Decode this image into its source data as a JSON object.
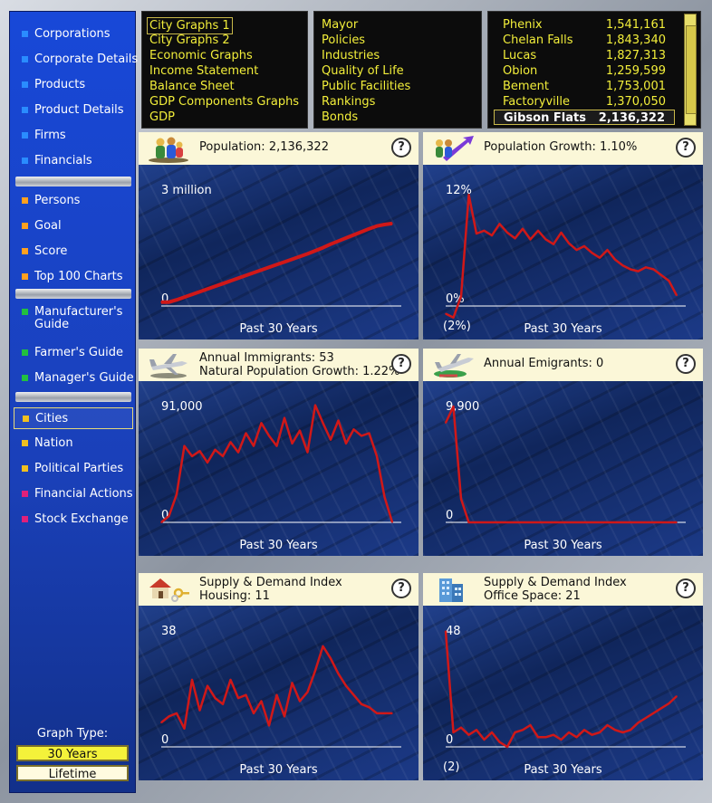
{
  "sidebar": {
    "items": [
      {
        "label": "Corporations",
        "color": "#2a8cff",
        "selected": false,
        "two_line": false
      },
      {
        "label": "Corporate Details",
        "color": "#2a8cff",
        "selected": false,
        "two_line": false
      },
      {
        "label": "Products",
        "color": "#2a8cff",
        "selected": false,
        "two_line": false
      },
      {
        "label": "Product Details",
        "color": "#2a8cff",
        "selected": false,
        "two_line": false
      },
      {
        "label": "Firms",
        "color": "#2a8cff",
        "selected": false,
        "two_line": false
      },
      {
        "label": "Financials",
        "color": "#2a8cff",
        "selected": false,
        "two_line": false
      },
      {
        "label": "Persons",
        "color": "#ffa020",
        "selected": false,
        "two_line": false
      },
      {
        "label": "Goal",
        "color": "#ffa020",
        "selected": false,
        "two_line": false
      },
      {
        "label": "Score",
        "color": "#ffa020",
        "selected": false,
        "two_line": false
      },
      {
        "label": "Top 100 Charts",
        "color": "#ffa020",
        "selected": false,
        "two_line": false
      },
      {
        "label": "Manufacturer's Guide",
        "color": "#22c040",
        "selected": false,
        "two_line": true
      },
      {
        "label": "Farmer's Guide",
        "color": "#22c040",
        "selected": false,
        "two_line": false
      },
      {
        "label": "Manager's Guide",
        "color": "#22c040",
        "selected": false,
        "two_line": false
      },
      {
        "label": "Cities",
        "color": "#f0c020",
        "selected": true,
        "two_line": false
      },
      {
        "label": "Nation",
        "color": "#f0c020",
        "selected": false,
        "two_line": false
      },
      {
        "label": "Political Parties",
        "color": "#f0c020",
        "selected": false,
        "two_line": false
      },
      {
        "label": "Financial Actions",
        "color": "#e0207a",
        "selected": false,
        "two_line": false
      },
      {
        "label": "Stock Exchange",
        "color": "#e0207a",
        "selected": false,
        "two_line": false
      }
    ],
    "graph_type_label": "Graph Type:",
    "graph_type_options": [
      "30 Years",
      "Lifetime"
    ],
    "graph_type_selected": "30 Years"
  },
  "menu_graphs": [
    "City Graphs 1",
    "City Graphs 2",
    "Economic Graphs",
    "Income Statement",
    "Balance Sheet",
    "GDP Components Graphs",
    "GDP"
  ],
  "menu_graphs_selected": "City Graphs 1",
  "menu_city": [
    "Mayor",
    "Policies",
    "Industries",
    "Quality of Life",
    "Public Facilities",
    "Rankings",
    "Bonds"
  ],
  "cities": [
    {
      "name": "Phenix",
      "pop": "1,541,161"
    },
    {
      "name": "Chelan Falls",
      "pop": "1,843,340"
    },
    {
      "name": "Lucas",
      "pop": "1,827,313"
    },
    {
      "name": "Obion",
      "pop": "1,259,599"
    },
    {
      "name": "Bement",
      "pop": "1,753,001"
    },
    {
      "name": "Factoryville",
      "pop": "1,370,050"
    },
    {
      "name": "Gibson Flats",
      "pop": "2,136,322"
    }
  ],
  "cities_selected": "Gibson Flats",
  "colors": {
    "line": "#d01818",
    "menu_text": "#f2ee3a",
    "header_bg": "#fbf7d8",
    "accent_sel": "#f4f23a"
  },
  "panels": [
    {
      "title": "Population: 2,136,322",
      "subtitle": "",
      "icon": "population-icon",
      "xlabel": "Past 30 Years"
    },
    {
      "title": "Population Growth: 1.10%",
      "subtitle": "",
      "icon": "population-growth-icon",
      "xlabel": "Past 30 Years"
    },
    {
      "title": "Annual Immigrants: 53",
      "subtitle": "Natural Population Growth: 1.22%",
      "icon": "airplane-icon",
      "xlabel": "Past 30 Years"
    },
    {
      "title": "Annual Emigrants: 0",
      "subtitle": "",
      "icon": "airplane-departing-icon",
      "xlabel": "Past 30 Years"
    },
    {
      "title": "Supply & Demand Index",
      "subtitle": "Housing: 11",
      "icon": "house-keys-icon",
      "xlabel": "Past 30 Years"
    },
    {
      "title": "Supply & Demand Index",
      "subtitle": "Office Space: 21",
      "icon": "office-building-icon",
      "xlabel": "Past 30 Years"
    }
  ],
  "chart_data": [
    {
      "type": "line",
      "title": "Population: 2,136,322",
      "xlabel": "Past 30 Years",
      "tick_labels": {
        "top": "3 million",
        "zero": "0"
      },
      "ylim": [
        0,
        3000000
      ],
      "values": [
        100000,
        100000,
        160000,
        230000,
        300000,
        370000,
        440000,
        510000,
        580000,
        650000,
        720000,
        790000,
        860000,
        930000,
        1000000,
        1070000,
        1140000,
        1210000,
        1280000,
        1350000,
        1430000,
        1510000,
        1600000,
        1680000,
        1760000,
        1840000,
        1920000,
        2000000,
        2070000,
        2110000,
        2136322
      ]
    },
    {
      "type": "line",
      "title": "Population Growth: 1.10%",
      "xlabel": "Past 30 Years",
      "tick_labels": {
        "top": "12%",
        "zero": "0%",
        "bottom": "(2%)"
      },
      "ylim": [
        -2,
        12
      ],
      "values": [
        -0.8,
        -1.2,
        1.0,
        11.5,
        7.5,
        7.8,
        7.3,
        8.5,
        7.6,
        7.0,
        8.0,
        6.9,
        7.8,
        6.9,
        6.4,
        7.6,
        6.5,
        5.8,
        6.2,
        5.5,
        5.0,
        5.8,
        4.8,
        4.2,
        3.8,
        3.6,
        4.0,
        3.8,
        3.2,
        2.6,
        1.1
      ]
    },
    {
      "type": "line",
      "title": "Annual Immigrants: 53",
      "subtitle": "Natural Population Growth: 1.22%",
      "xlabel": "Past 30 Years",
      "tick_labels": {
        "top": "91,000",
        "zero": "0"
      },
      "ylim": [
        0,
        91000
      ],
      "values": [
        0,
        5000,
        22000,
        60000,
        52000,
        56000,
        47000,
        57000,
        52000,
        63000,
        55000,
        70000,
        60000,
        78000,
        68000,
        60000,
        82000,
        62000,
        72000,
        55000,
        92000,
        78000,
        65000,
        80000,
        62000,
        73000,
        68000,
        70000,
        52000,
        20000,
        53
      ]
    },
    {
      "type": "line",
      "title": "Annual Emigrants: 0",
      "xlabel": "Past 30 Years",
      "tick_labels": {
        "top": "9,900",
        "zero": "0"
      },
      "ylim": [
        0,
        9900
      ],
      "values": [
        8500,
        9900,
        2000,
        0,
        0,
        0,
        0,
        0,
        0,
        0,
        0,
        0,
        0,
        0,
        0,
        0,
        0,
        0,
        0,
        0,
        0,
        0,
        0,
        0,
        0,
        0,
        0,
        0,
        0,
        0,
        0
      ]
    },
    {
      "type": "line",
      "title": "Supply & Demand Index",
      "subtitle": "Housing: 11",
      "xlabel": "Past 30 Years",
      "tick_labels": {
        "top": "38",
        "zero": "0"
      },
      "ylim": [
        0,
        38
      ],
      "values": [
        8,
        10,
        11,
        6,
        22,
        12,
        20,
        16,
        14,
        22,
        16,
        17,
        11,
        15,
        7,
        17,
        10,
        21,
        15,
        18,
        25,
        33,
        29,
        24,
        20,
        17,
        14,
        13,
        11,
        11,
        11
      ]
    },
    {
      "type": "line",
      "title": "Supply & Demand Index",
      "subtitle": "Office Space: 21",
      "xlabel": "Past 30 Years",
      "tick_labels": {
        "top": "48",
        "zero": "0",
        "bottom": "(2)"
      },
      "ylim": [
        -2,
        48
      ],
      "values": [
        48,
        6,
        8,
        5,
        7,
        3,
        6,
        2,
        0,
        6,
        7,
        9,
        4,
        4,
        5,
        3,
        6,
        4,
        7,
        5,
        6,
        9,
        7,
        6,
        7,
        10,
        12,
        14,
        16,
        18,
        21
      ]
    }
  ]
}
